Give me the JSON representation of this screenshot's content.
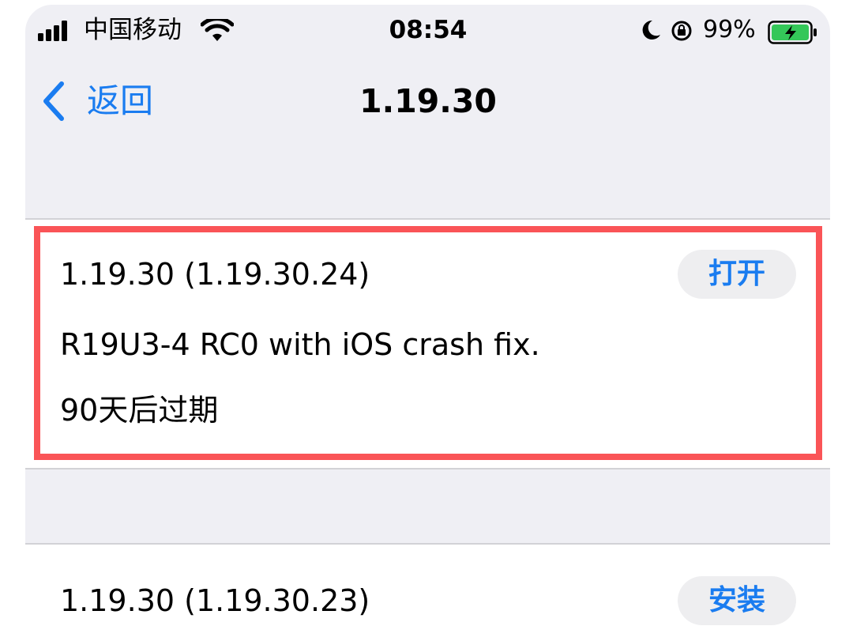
{
  "status_bar": {
    "carrier": "中国移动",
    "time": "08:54",
    "battery_percent": "99%",
    "icons": [
      "signal-icon",
      "wifi-icon",
      "moon-icon",
      "lock-rotation-icon",
      "battery-charging-icon"
    ]
  },
  "nav": {
    "back_label": "返回",
    "title": "1.19.30"
  },
  "builds": [
    {
      "version": "1.19.30 (1.19.30.24)",
      "notes": "R19U3-4 RC0 with iOS crash fix.",
      "expiry": "90天后过期",
      "action_label": "打开"
    },
    {
      "version": "1.19.30 (1.19.30.23)",
      "action_label": "安装"
    }
  ],
  "colors": {
    "accent": "#1a7cf0",
    "highlight": "#fa5457",
    "background": "#efeff4",
    "battery": "#34c759"
  }
}
